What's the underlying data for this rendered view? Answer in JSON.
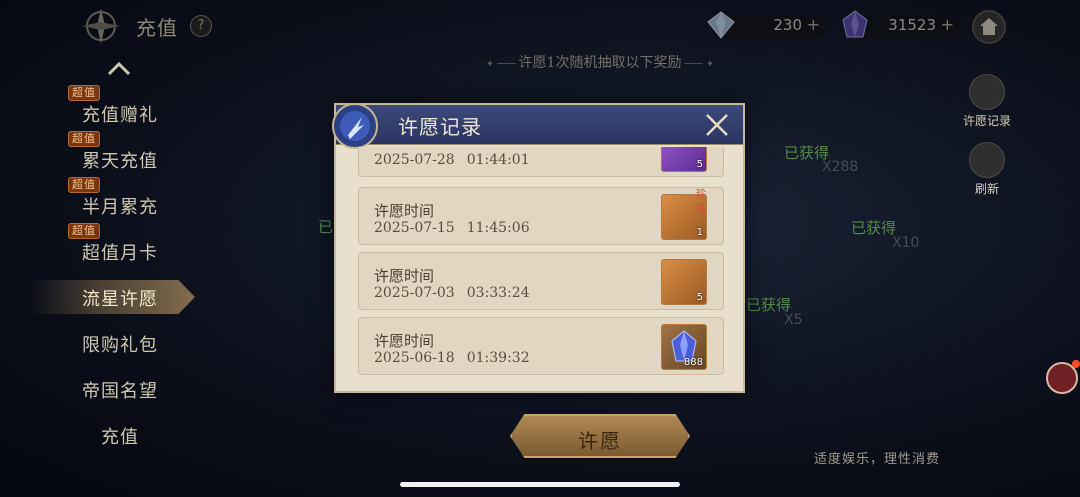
{
  "header": {
    "title": "充值",
    "help_symbol": "?",
    "currencies": [
      {
        "icon": "diamond-icon",
        "value": "230",
        "plus": "+"
      },
      {
        "icon": "crystal-icon",
        "value": "31523",
        "plus": "+"
      }
    ],
    "home_icon": "home-icon"
  },
  "banner": {
    "text": "许愿1次随机抽取以下奖励"
  },
  "sidebar": {
    "items": [
      {
        "label": "充值赠礼",
        "tag": "超值"
      },
      {
        "label": "累天充值",
        "tag": "超值"
      },
      {
        "label": "半月累充",
        "tag": "超值"
      },
      {
        "label": "超值月卡",
        "tag": "超值"
      },
      {
        "label": "流星许愿",
        "tag": "",
        "active": true
      },
      {
        "label": "限购礼包",
        "tag": ""
      },
      {
        "label": "帝国名望",
        "tag": ""
      },
      {
        "label": "充值",
        "tag": ""
      }
    ]
  },
  "right_side": {
    "history_label": "许愿记录",
    "refresh_label": "刷新"
  },
  "background_nodes": [
    {
      "label": "已获得",
      "mul": "X288"
    },
    {
      "label": "已获得",
      "mul": "X10"
    },
    {
      "label": "已获得",
      "mul": "X5"
    },
    {
      "label": "已",
      "mul": ""
    }
  ],
  "modal": {
    "title": "许愿记录",
    "records": [
      {
        "label": "",
        "date": "2025-07-28",
        "time": "01:44:01",
        "item": "purple-gem-icon",
        "qty": "5",
        "badge": ""
      },
      {
        "label": "许愿时间",
        "date": "2025-07-15",
        "time": "11:45:06",
        "item": "mystery-card-icon",
        "qty": "1",
        "badge": "珍品"
      },
      {
        "label": "许愿时间",
        "date": "2025-07-03",
        "time": "03:33:24",
        "item": "coin-card-icon",
        "qty": "5",
        "badge": ""
      },
      {
        "label": "许愿时间",
        "date": "2025-06-18",
        "time": "01:39:32",
        "item": "blue-crystal-icon",
        "qty": "888",
        "badge": ""
      }
    ]
  },
  "wish_button": {
    "label": "许愿"
  },
  "footer": {
    "text": "适度娱乐，理性消费"
  }
}
